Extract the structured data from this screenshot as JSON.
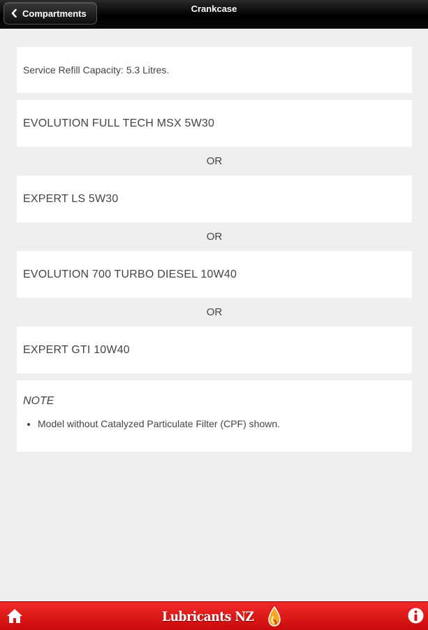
{
  "header": {
    "back_label": "Compartments",
    "title": "Crankcase"
  },
  "capacity": "Service Refill Capacity: 5.3 Litres.",
  "products": [
    "EVOLUTION FULL TECH MSX 5W30",
    "EXPERT LS 5W30",
    "EVOLUTION 700 TURBO DIESEL 10W40",
    "EXPERT GTI 10W40"
  ],
  "or_label": "OR",
  "note": {
    "title": "NOTE",
    "items": [
      "Model without Catalyzed Particulate Filter (CPF) shown."
    ]
  },
  "footer": {
    "brand": "Lubricants NZ",
    "icons": {
      "home": "home-icon",
      "info": "info-icon",
      "logo": "oil-drop-icon"
    }
  },
  "colors": {
    "header_bg": "#000000",
    "footer_bg": "#e01414",
    "page_bg": "#efefef",
    "card_bg": "#ffffff",
    "text": "#444444"
  }
}
